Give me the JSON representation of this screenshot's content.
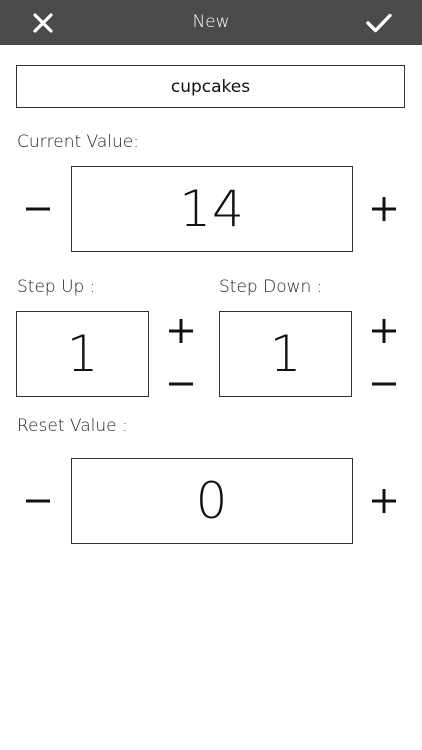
{
  "header": {
    "title": "New",
    "close_icon": "close-icon",
    "confirm_icon": "checkmark-icon",
    "background": "#4a4a4a"
  },
  "name": {
    "value": "cupcakes"
  },
  "current": {
    "label": "Current Value:",
    "value": "14"
  },
  "step_up": {
    "label": "Step Up :",
    "value": "1"
  },
  "step_down": {
    "label": "Step Down :",
    "value": "1"
  },
  "reset": {
    "label": "Reset Value :",
    "value": "0"
  },
  "icons": {
    "decrement": "minus-icon",
    "increment": "plus-icon"
  }
}
